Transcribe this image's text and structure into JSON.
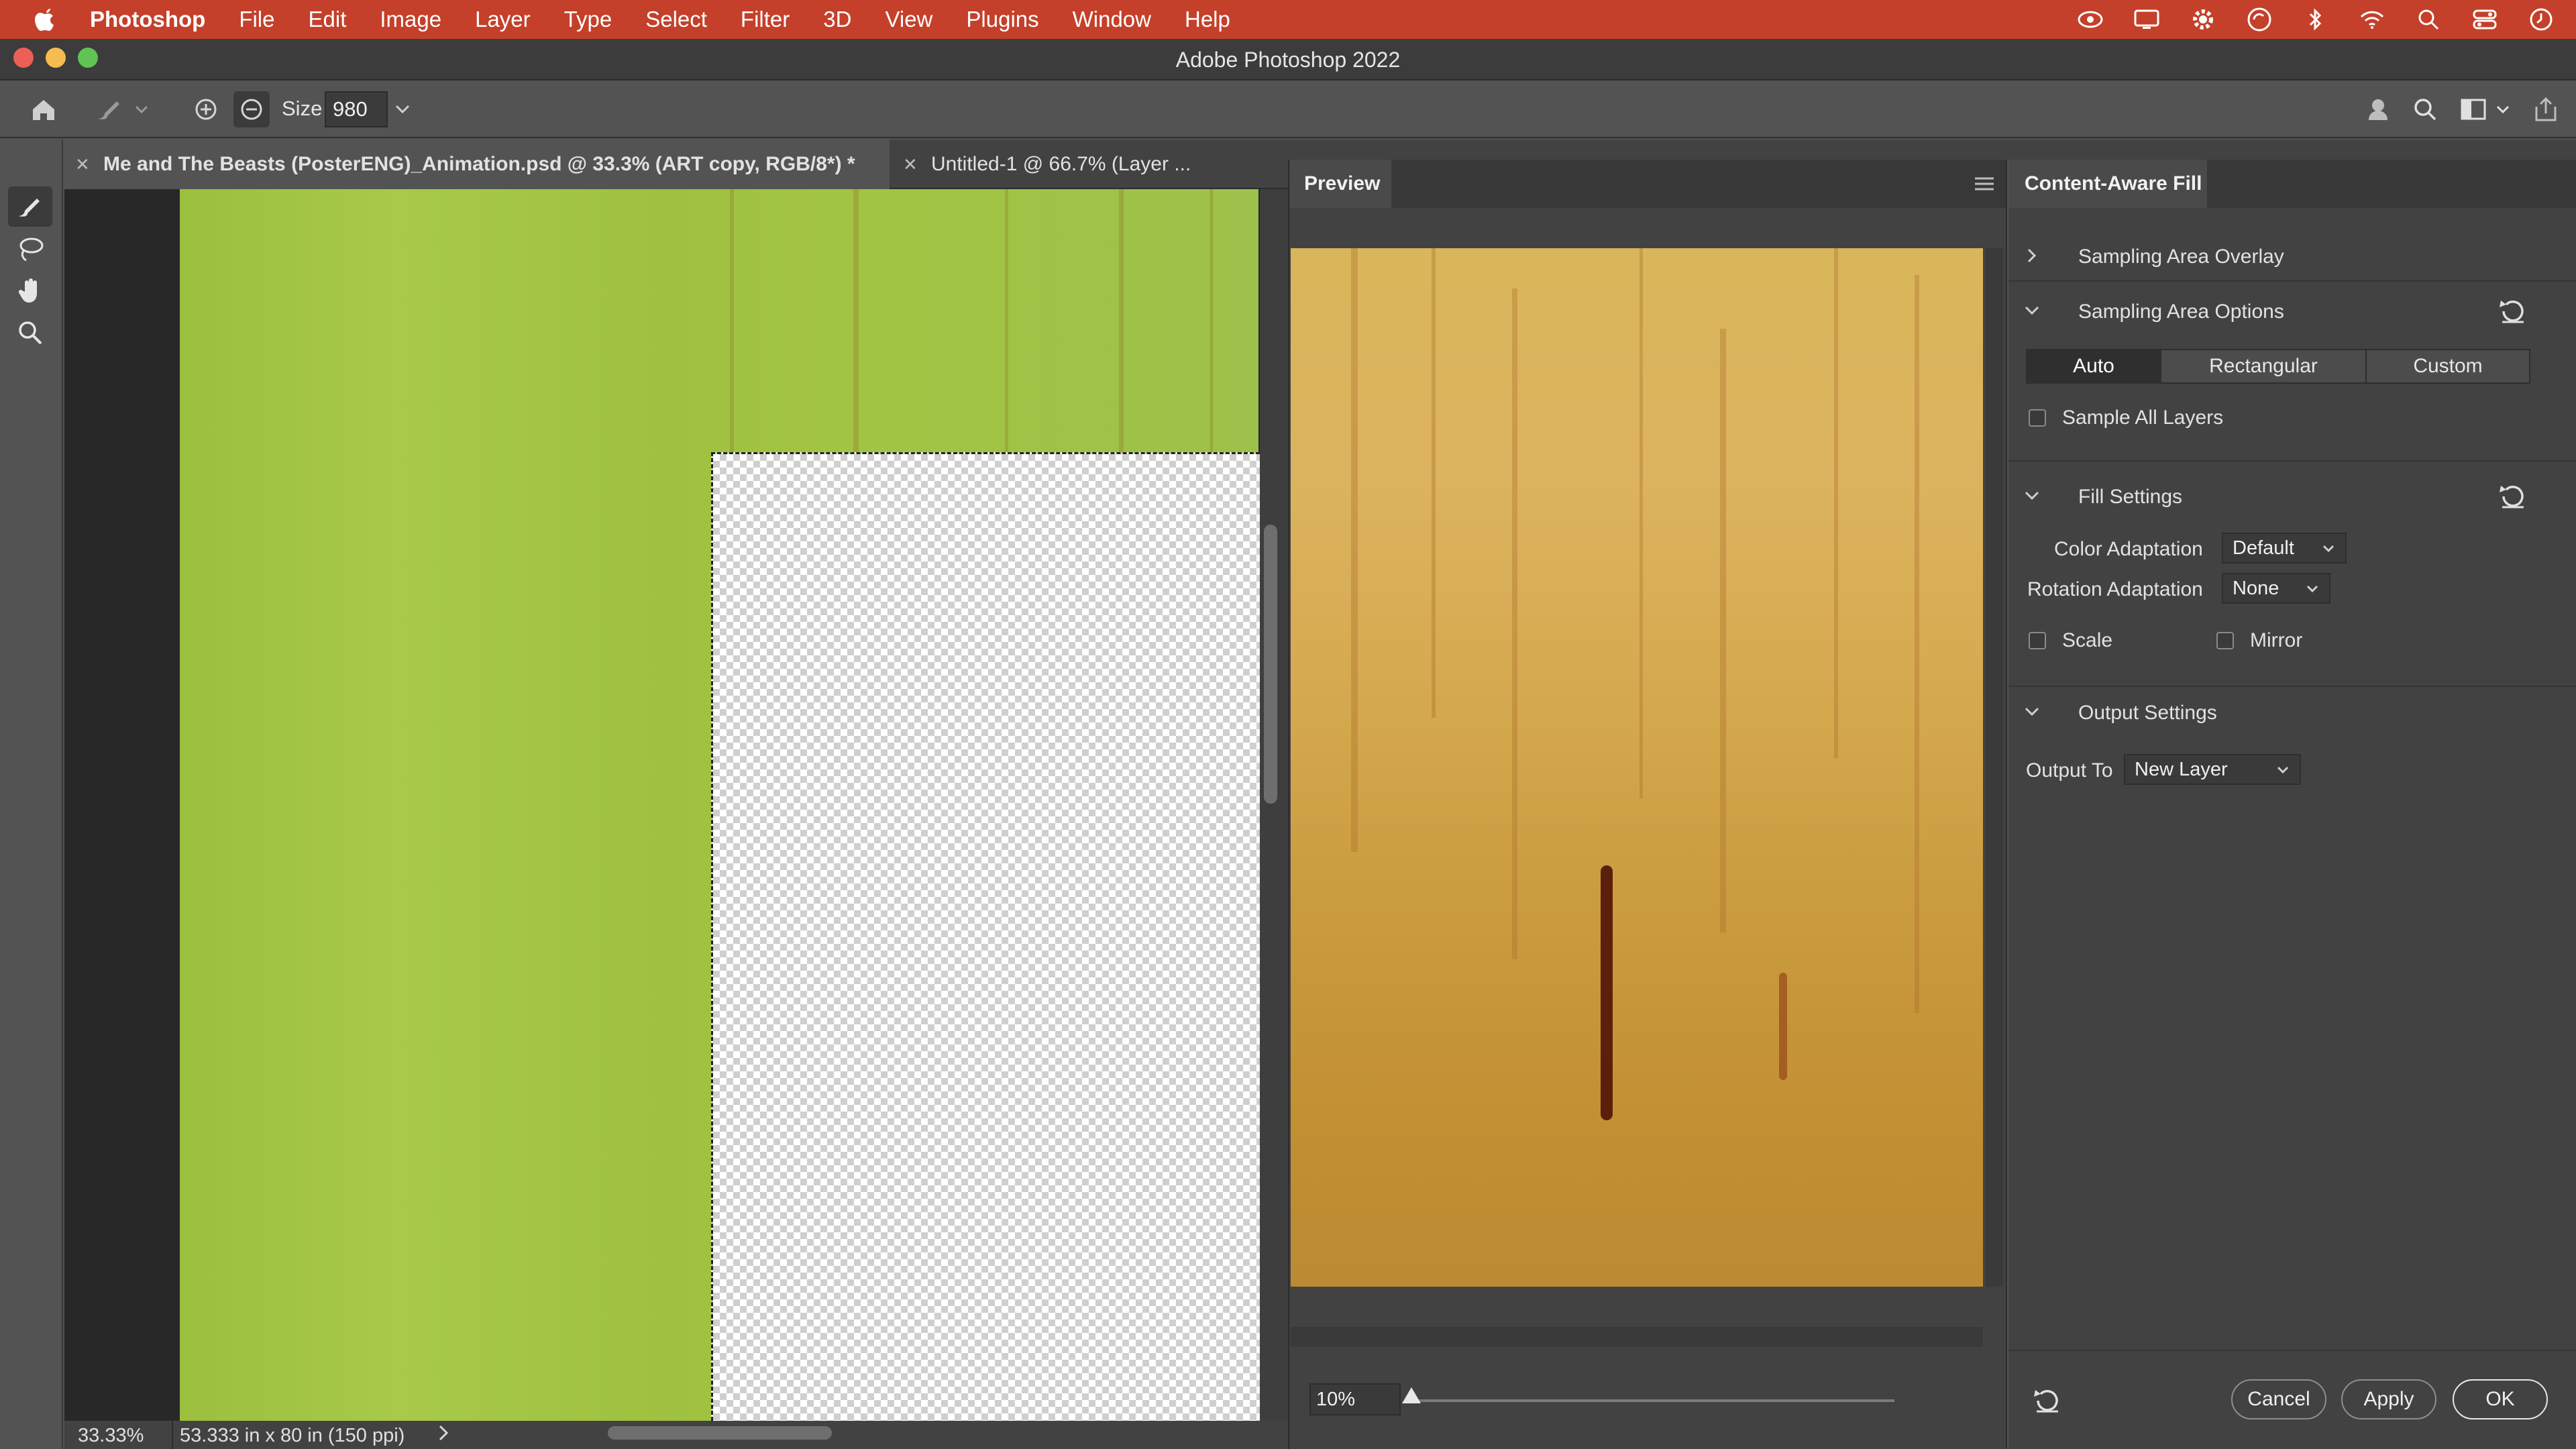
{
  "menubar": {
    "app": "Photoshop",
    "items": [
      "File",
      "Edit",
      "Image",
      "Layer",
      "Type",
      "Select",
      "Filter",
      "3D",
      "View",
      "Plugins",
      "Window",
      "Help"
    ]
  },
  "window": {
    "title": "Adobe Photoshop 2022"
  },
  "options": {
    "size_label": "Size",
    "size_value": "980"
  },
  "tabs": [
    {
      "label": "Me and The Beasts (PosterENG)_Animation.psd @ 33.3% (ART copy, RGB/8*) *"
    },
    {
      "label": "Untitled-1 @ 66.7% (Layer ..."
    }
  ],
  "status": {
    "zoom": "33.33%",
    "info": "53.333 in x 80 in (150 ppi)"
  },
  "preview": {
    "tab": "Preview",
    "zoom": "10%",
    "zoom_fraction": 0.0
  },
  "caf": {
    "tab": "Content-Aware Fill",
    "sampling_overlay": "Sampling Area Overlay",
    "sampling_options": "Sampling Area Options",
    "segments": [
      "Auto",
      "Rectangular",
      "Custom"
    ],
    "sample_all_layers": "Sample All Layers",
    "fill_settings": "Fill Settings",
    "color_adaptation_label": "Color Adaptation",
    "color_adaptation_value": "Default",
    "rotation_adaptation_label": "Rotation Adaptation",
    "rotation_adaptation_value": "None",
    "scale": "Scale",
    "mirror": "Mirror",
    "output_settings": "Output Settings",
    "output_to_label": "Output To",
    "output_to_value": "New Layer",
    "cancel": "Cancel",
    "apply": "Apply",
    "ok": "OK"
  },
  "colors": {
    "menubar": "#c4402a",
    "canvas_green": "#a2c443",
    "preview_gold": "#d4a84d"
  }
}
